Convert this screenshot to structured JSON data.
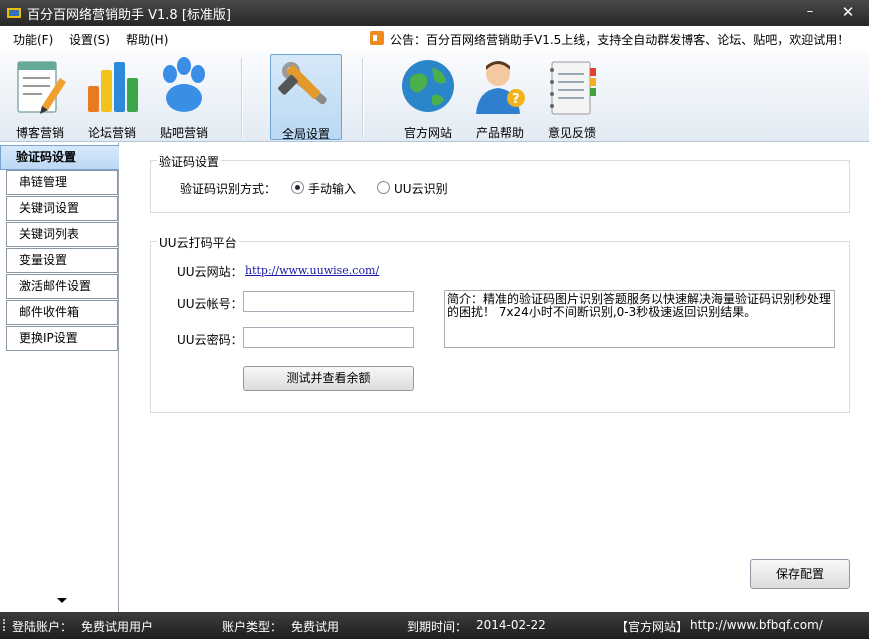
{
  "window": {
    "title": "百分百网络营销助手 V1.8 [标准版]",
    "minimize": "–",
    "close": "✕"
  },
  "menu": {
    "items": [
      "功能(F)",
      "设置(S)",
      "帮助(H)"
    ],
    "notice": "公告：百分百网络营销助手V1.5上线，支持全自动群发博客、论坛、贴吧，欢迎试用！"
  },
  "toolbar": {
    "items": [
      {
        "label": "博客营销",
        "icon": "blog-notepad-icon"
      },
      {
        "label": "论坛营销",
        "icon": "bar-chart-icon"
      },
      {
        "label": "贴吧营销",
        "icon": "paw-icon"
      },
      {
        "label": "全局设置",
        "icon": "tools-icon"
      },
      {
        "label": "官方网站",
        "icon": "globe-icon"
      },
      {
        "label": "产品帮助",
        "icon": "help-person-icon"
      },
      {
        "label": "意见反馈",
        "icon": "notebook-icon"
      }
    ],
    "active": "全局设置"
  },
  "sidebar": {
    "items": [
      "验证码设置",
      "串链管理",
      "关键词设置",
      "关键词列表",
      "变量设置",
      "激活邮件设置",
      "邮件收件箱",
      "更换IP设置"
    ],
    "active": "验证码设置"
  },
  "captcha_group": {
    "title": "验证码设置",
    "method_label": "验证码识别方式：",
    "options": [
      "手动输入",
      "UU云识别"
    ],
    "selected": "手动输入"
  },
  "uu_group": {
    "title": "UU云打码平台",
    "site_label": "UU云网站：",
    "site_url": "http://www.uuwise.com/",
    "account_label": "UU云帐号：",
    "account_value": "",
    "password_label": "UU云密码：",
    "password_value": "",
    "test_button": "测试并查看余额",
    "description": "简介：精准的验证码图片识别答题服务以快速解决海量验证码识别秒处理的困扰！ 7x24小时不间断识别,0-3秒极速返回识别结果。"
  },
  "save_button": "保存配置",
  "status": {
    "login_label": "登陆账户：",
    "login_value": "免费试用用户",
    "type_label": "账户类型：",
    "type_value": "免费试用",
    "expire_label": "到期时间：",
    "expire_value": "2014-02-22",
    "site_label": "【官方网站】",
    "site_value": "http://www.bfbqf.com/"
  },
  "colors": {
    "titlebar": "#2f2f2f",
    "active_tab": "#bcd8f5",
    "link": "#1a1aa6"
  }
}
